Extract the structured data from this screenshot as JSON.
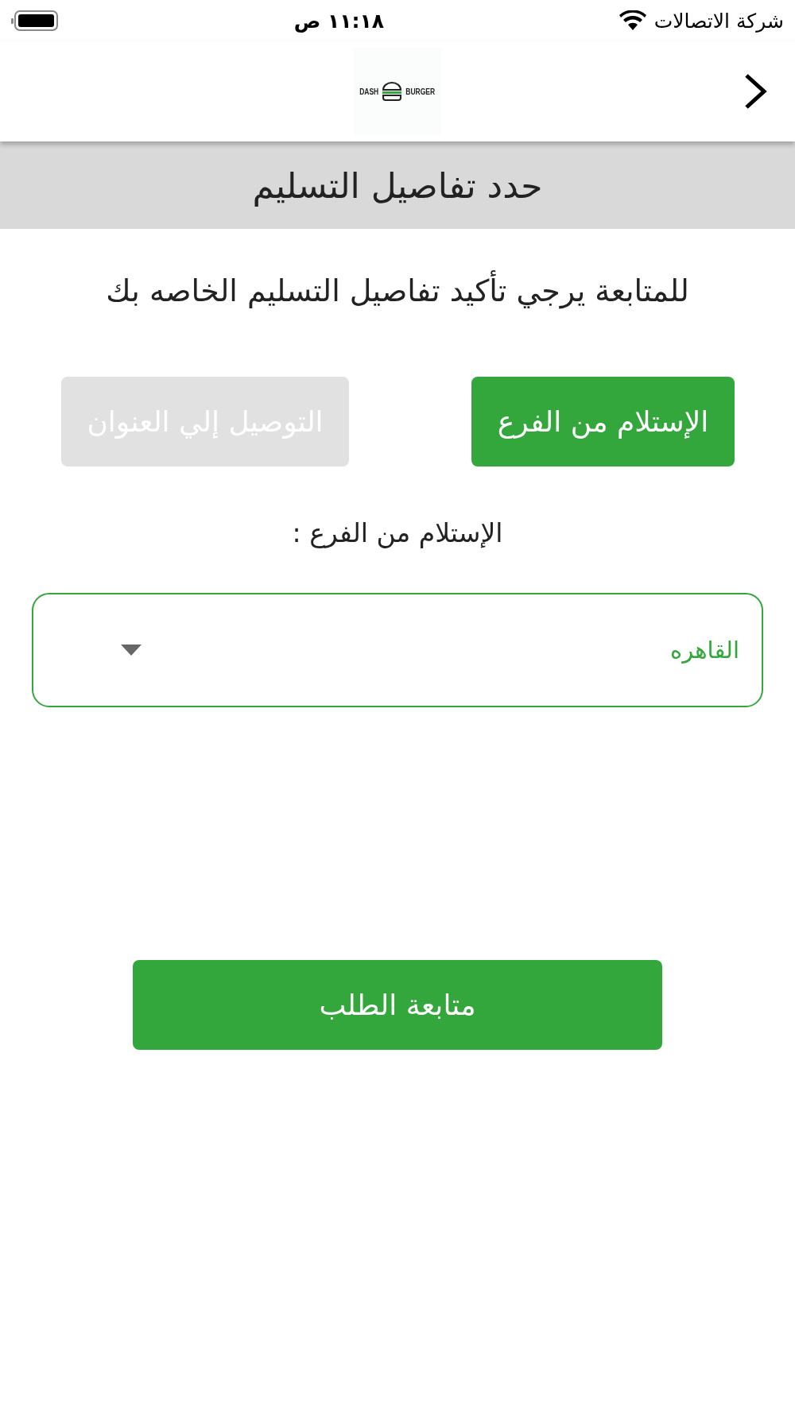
{
  "status_bar": {
    "carrier": "شركة الاتصالات",
    "time": "١١:١٨ ص"
  },
  "header": {
    "logo_left": "DASH",
    "logo_right": "BURGER"
  },
  "title": "حدد تفاصيل التسليم",
  "instruction": "للمتابعة يرجي تأكيد تفاصيل التسليم الخاصه بك",
  "delivery_options": [
    {
      "label": "الإستلام من الفرع",
      "selected": true
    },
    {
      "label": "التوصيل إلي العنوان",
      "selected": false
    }
  ],
  "branch_label": "الإستلام من الفرع :",
  "branch_select": {
    "value": "القاهره"
  },
  "submit_button": "متابعة الطلب"
}
